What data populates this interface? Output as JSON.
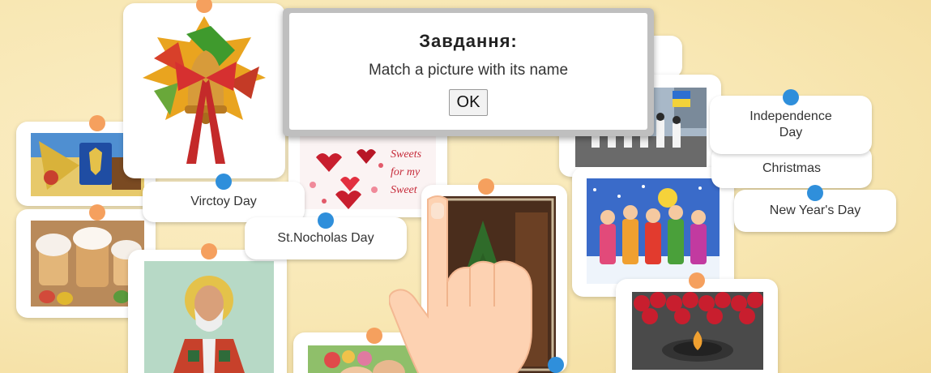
{
  "dialog": {
    "title": "Завдання:",
    "message": "Match a picture with its name",
    "ok_label": "OK"
  },
  "labels": {
    "victory_day": "Virctoy Day",
    "st_nicholas_day": "St.Nocholas Day",
    "independence_day": "Independence Day",
    "christmas": "Christmas",
    "new_years_day": "New Year's Day"
  },
  "picture_text": {
    "sweets_line1": "Sweets",
    "sweets_line2": "for my",
    "sweets_line3": "Sweet"
  },
  "colors": {
    "pin_orange": "#f5a05e",
    "pin_blue": "#2f8fdb",
    "board_background": "#f8e7b3"
  }
}
